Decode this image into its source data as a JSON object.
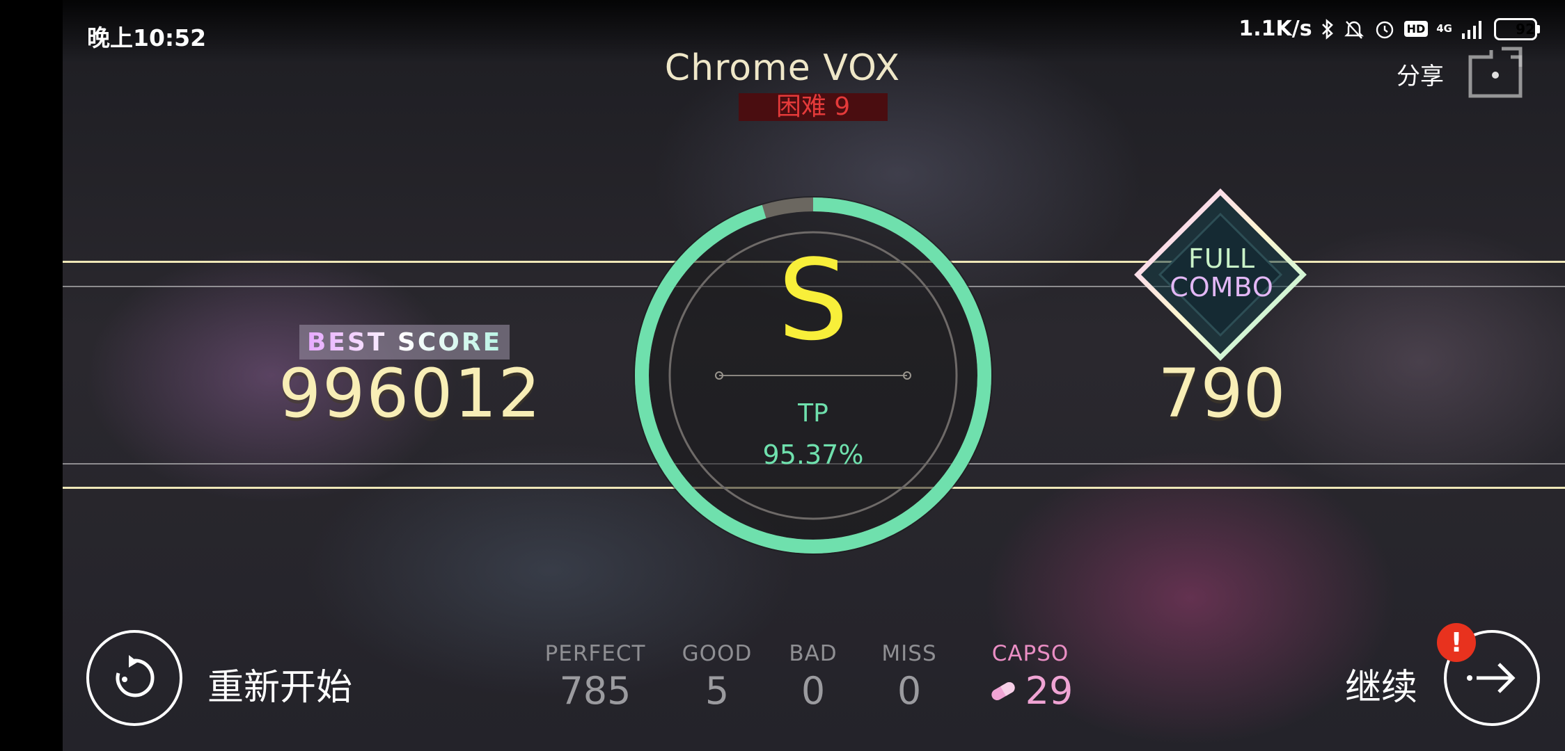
{
  "status_bar": {
    "time": "晚上10:52",
    "network_speed": "1.1K/s",
    "hd": "HD",
    "network_type": "4G",
    "battery": "92"
  },
  "song": {
    "title": "Chrome VOX",
    "difficulty": "困难 9"
  },
  "share": {
    "label": "分享"
  },
  "best_score": {
    "label": "BEST SCORE",
    "value": "996012"
  },
  "result": {
    "rank": "S",
    "tp_label": "TP",
    "tp_value": "95.37%",
    "tp_fraction": 0.9537
  },
  "combo": {
    "badge_line1": "FULL",
    "badge_line2": "COMBO",
    "max_combo": "790"
  },
  "judgements": {
    "perfect": {
      "label": "PERFECT",
      "value": "785"
    },
    "good": {
      "label": "GOOD",
      "value": "5"
    },
    "bad": {
      "label": "BAD",
      "value": "0"
    },
    "miss": {
      "label": "MISS",
      "value": "0"
    },
    "capso": {
      "label": "CAPSO",
      "value": "29"
    }
  },
  "controls": {
    "restart_label": "重新开始",
    "continue_label": "继续",
    "alert": "!"
  },
  "colors": {
    "ring_accent": "#6fe0ad",
    "rank": "#f8ef3a",
    "score": "#f8eeb6",
    "difficulty": "#e53a3a",
    "capso": "#ea8ec4",
    "alert": "#e8321e"
  }
}
